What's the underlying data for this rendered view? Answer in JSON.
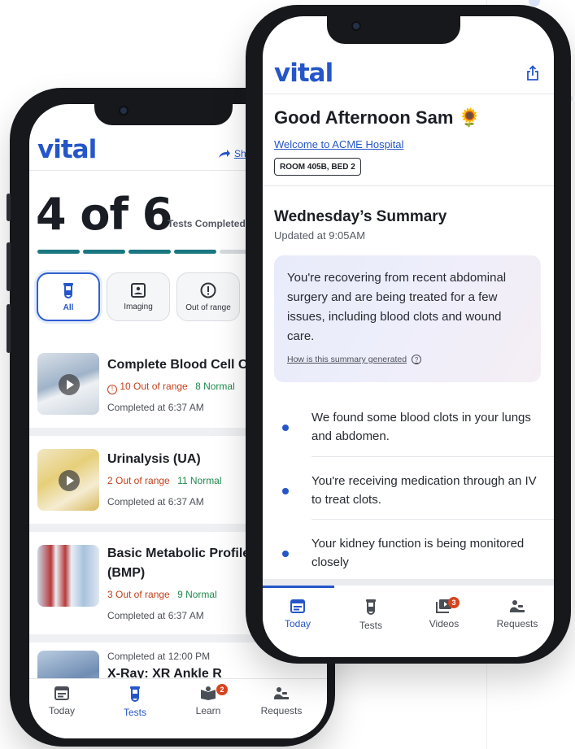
{
  "back_phone": {
    "logo": "vital",
    "share_label": "Sh",
    "test_count": "4 of 6",
    "count_caption": "Tests Completed",
    "progress": {
      "completed": 4,
      "total": 6
    },
    "filters": [
      {
        "label": "All",
        "icon": "test-tube-icon",
        "active": true
      },
      {
        "label": "Imaging",
        "icon": "image-frame-icon",
        "active": false
      },
      {
        "label": "Out of range",
        "icon": "alert-circle-icon",
        "active": false
      }
    ],
    "tests": [
      {
        "title": "Complete Blood Cell Co",
        "out_of_range": "10 Out of range",
        "normal": "8 Normal",
        "completed": "Completed at 6:37 AM",
        "alert_icon": true
      },
      {
        "title": "Urinalysis (UA)",
        "out_of_range": "2 Out of range",
        "normal": "11 Normal",
        "completed": "Completed at 6:37 AM",
        "alert_icon": false
      },
      {
        "title": "Basic Metabolic Profile",
        "title_line2": "(BMP)",
        "out_of_range": "3 Out of range",
        "normal": "9 Normal",
        "completed": "Completed at 6:37 AM",
        "alert_icon": false
      },
      {
        "title": "X-Ray: XR Ankle R",
        "completed": "Completed at 12:00 PM"
      }
    ],
    "tabs": [
      {
        "label": "Today",
        "icon": "calendar-icon",
        "active": false
      },
      {
        "label": "Tests",
        "icon": "test-tube-icon",
        "active": true
      },
      {
        "label": "Learn",
        "icon": "book-icon",
        "active": false,
        "badge": "2"
      },
      {
        "label": "Requests",
        "icon": "nurse-call-icon",
        "active": false
      }
    ]
  },
  "front_phone": {
    "logo": "vital",
    "greeting": "Good Afternoon Sam 🌻",
    "welcome_link": "Welcome to ACME Hospital",
    "room": "ROOM 405B, BED 2",
    "summary_title": "Wednesday’s Summary",
    "summary_updated": "Updated at 9:05AM",
    "summary_text": "You're recovering from recent abdominal surgery and are being treated for a few issues, including blood clots and wound care.",
    "summary_link": "How is this summary generated",
    "points": [
      "We found some blood clots in your lungs and abdomen.",
      "You're receiving medication through an IV to treat clots.",
      "Your kidney function is being monitored closely"
    ],
    "tabs": [
      {
        "label": "Today",
        "icon": "calendar-icon",
        "active": true
      },
      {
        "label": "Tests",
        "icon": "test-tube-icon",
        "active": false
      },
      {
        "label": "Videos",
        "icon": "video-library-icon",
        "active": false,
        "badge": "3"
      },
      {
        "label": "Requests",
        "icon": "nurse-call-icon",
        "active": false
      }
    ]
  },
  "colors": {
    "brand": "#2556c9",
    "progress": "#1a7680",
    "out_of_range": "#c4401b",
    "normal": "#1e8a4c",
    "badge": "#d6431f"
  }
}
